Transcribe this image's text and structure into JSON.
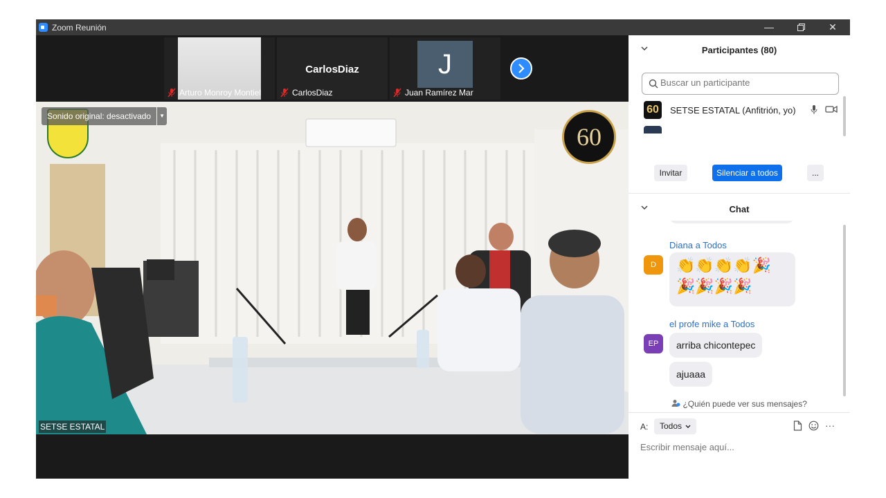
{
  "window": {
    "title": "Zoom Reunión"
  },
  "strip": {
    "tiles": [
      {
        "name": "Arturo Monroy Montiel"
      },
      {
        "name": "CarlosDiaz",
        "display": "CarlosDiaz"
      },
      {
        "name": "Juan Ramírez Mar",
        "initial": "J"
      }
    ],
    "next_label": "›"
  },
  "main_video": {
    "original_sound": "Sonido original: desactivado",
    "speaker": "SETSE ESTATAL",
    "badge": "60"
  },
  "participants": {
    "title": "Participantes (80)",
    "search_placeholder": "Buscar un participante",
    "rows": [
      {
        "avatar": "60",
        "name": "SETSE ESTATAL (Anfitrión, yo)"
      }
    ],
    "invite": "Invitar",
    "mute_all": "Silenciar a todos",
    "more": "..."
  },
  "chat": {
    "title": "Chat",
    "messages": [
      {
        "sender": "Diana a Todos",
        "initial": "D",
        "avatar_color": "#f0960c",
        "emoji_line1": "👏👏👏👏🎉",
        "emoji_line2": "🎉🎉🎉🎉"
      },
      {
        "sender": "el profe mike a Todos",
        "initial": "EP",
        "avatar_color": "#7b3fb5",
        "texts": [
          "arriba chicontepec",
          "ajuaaa"
        ]
      }
    ],
    "who_sees": "¿Quién puede ver sus mensajes?",
    "to_label": "A:",
    "to_value": "Todos",
    "input_placeholder": "Escribir mensaje aquí..."
  }
}
